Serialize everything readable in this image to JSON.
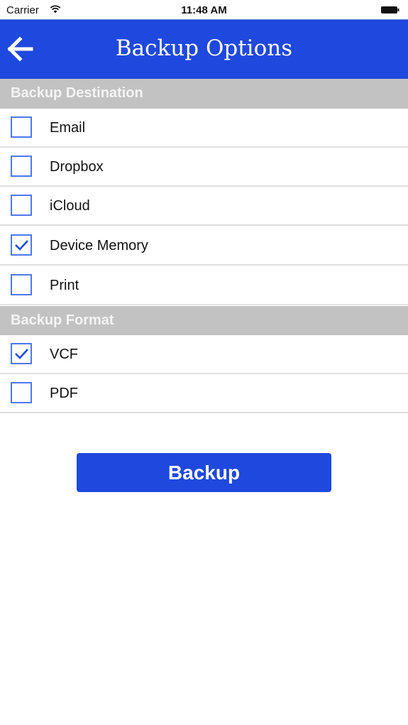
{
  "status_bar": {
    "carrier": "Carrier",
    "time": "11:48 AM"
  },
  "nav": {
    "title": "Backup Options",
    "back_icon": "arrow-left-icon"
  },
  "sections": [
    {
      "title": "Backup Destination",
      "items": [
        {
          "label": "Email",
          "checked": false
        },
        {
          "label": "Dropbox",
          "checked": false
        },
        {
          "label": "iCloud",
          "checked": false
        },
        {
          "label": "Device Memory",
          "checked": true
        },
        {
          "label": "Print",
          "checked": false
        }
      ]
    },
    {
      "title": "Backup Format",
      "items": [
        {
          "label": "VCF",
          "checked": true
        },
        {
          "label": "PDF",
          "checked": false
        }
      ]
    }
  ],
  "actions": {
    "backup_label": "Backup"
  },
  "colors": {
    "primary": "#1f48de",
    "section_bg": "#c2c2c2",
    "checkbox_border": "#4d78f0"
  }
}
